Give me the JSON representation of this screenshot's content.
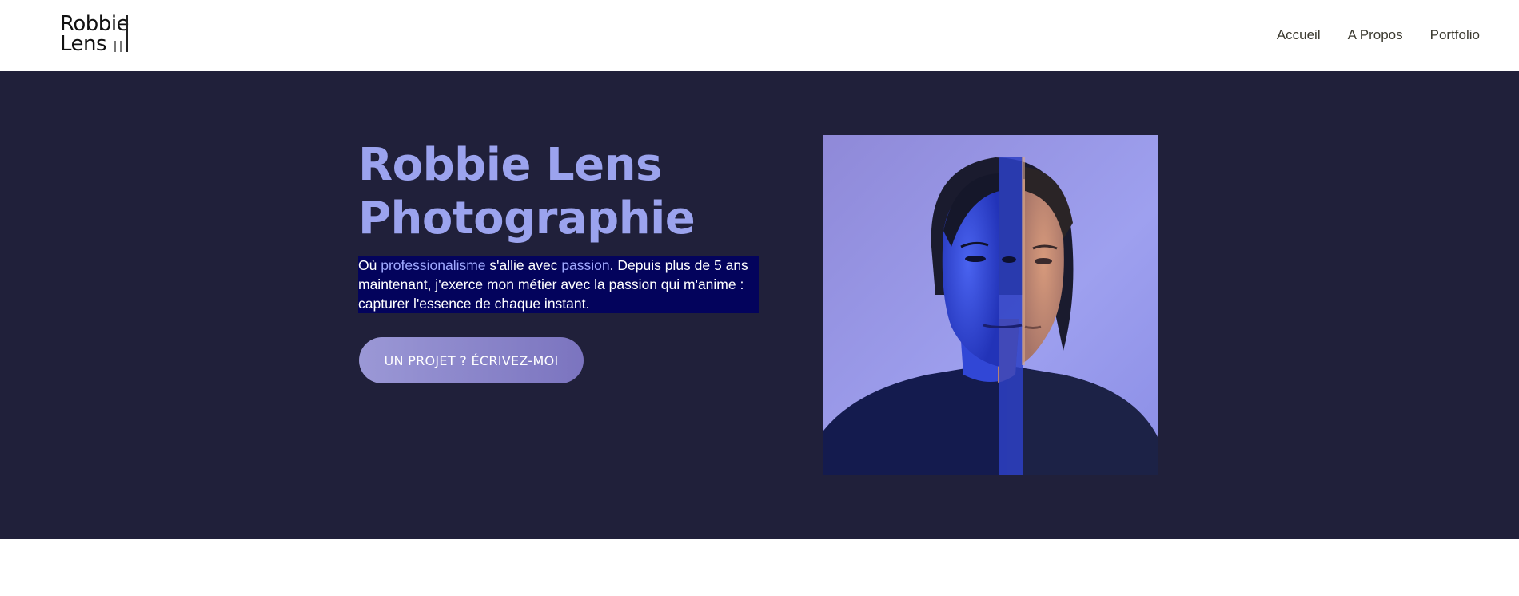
{
  "header": {
    "logo_line1": "Robbie",
    "logo_line2": "Lens",
    "nav": [
      "Accueil",
      "A Propos",
      "Portfolio"
    ]
  },
  "hero": {
    "title_line1": "Robbie Lens",
    "title_line2": "Photographie",
    "intro": {
      "p1": "Où ",
      "hl1": "professionalisme",
      "p2": " s'allie avec ",
      "hl2": "passion",
      "p3": ". Depuis plus de 5 ans maintenant, j'exerce mon métier avec la passion qui m'anime : capturer l'essence de chaque instant."
    },
    "cta_label": "UN PROJET ? ÉCRIVEZ-MOI",
    "portrait_icon": "portrait-photo"
  },
  "colors": {
    "hero_bg": "#20203a",
    "accent": "#9ba3ee",
    "highlight_bg": "#03035c"
  }
}
